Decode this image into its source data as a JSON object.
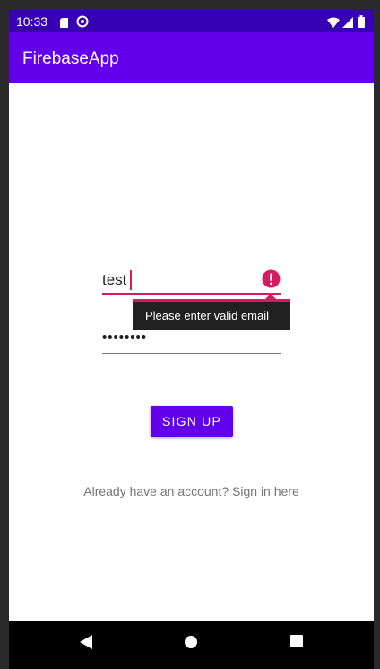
{
  "status_bar": {
    "time": "10:33",
    "icons": [
      "sd-card-icon",
      "do-not-disturb-icon",
      "wifi-icon",
      "signal-icon",
      "battery-icon"
    ]
  },
  "app_bar": {
    "title": "FirebaseApp"
  },
  "form": {
    "email_value": "test",
    "email_error": "Please enter valid email",
    "password_value": "••••••••",
    "signup_label": "SIGN UP",
    "signin_link": "Already have an account? Sign in here"
  },
  "nav_bar": {
    "icons": [
      "back-icon",
      "home-icon",
      "recents-icon"
    ]
  },
  "colors": {
    "status_bar": "#3700b3",
    "primary": "#6200ee",
    "error": "#d81b60",
    "popup_bg": "#212121",
    "link_text": "#757575"
  }
}
